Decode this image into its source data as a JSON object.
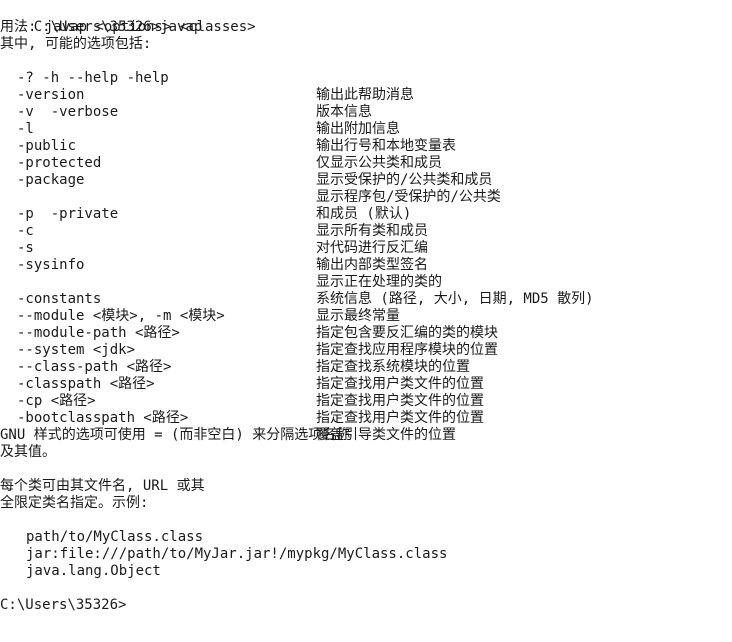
{
  "prompt": {
    "cwd": "C:\\Users\\35326>",
    "command": "javap"
  },
  "usage": {
    "line1": "用法: javap <options> <classes>",
    "line2": "其中, 可能的选项包括:"
  },
  "options": [
    {
      "opt": "-? -h --help -help",
      "desc": "输出此帮助消息"
    },
    {
      "opt": "-version",
      "desc": "版本信息"
    },
    {
      "opt": "-v  -verbose",
      "desc": "输出附加信息"
    },
    {
      "opt": "-l",
      "desc": "输出行号和本地变量表"
    },
    {
      "opt": "-public",
      "desc": "仅显示公共类和成员"
    },
    {
      "opt": "-protected",
      "desc": "显示受保护的/公共类和成员"
    },
    {
      "opt": "-package",
      "desc": "显示程序包/受保护的/公共类"
    },
    {
      "opt": "",
      "desc": "和成员 (默认)"
    },
    {
      "opt": "-p  -private",
      "desc": "显示所有类和成员"
    },
    {
      "opt": "-c",
      "desc": "对代码进行反汇编"
    },
    {
      "opt": "-s",
      "desc": "输出内部类型签名"
    },
    {
      "opt": "-sysinfo",
      "desc": "显示正在处理的类的"
    },
    {
      "opt": "",
      "desc": "系统信息 (路径, 大小, 日期, MD5 散列)"
    },
    {
      "opt": "-constants",
      "desc": "显示最终常量"
    },
    {
      "opt": "--module <模块>, -m <模块>",
      "desc": "指定包含要反汇编的类的模块"
    },
    {
      "opt": "--module-path <路径>",
      "desc": "指定查找应用程序模块的位置"
    },
    {
      "opt": "--system <jdk>",
      "desc": "指定查找系统模块的位置"
    },
    {
      "opt": "--class-path <路径>",
      "desc": "指定查找用户类文件的位置"
    },
    {
      "opt": "-classpath <路径>",
      "desc": "指定查找用户类文件的位置"
    },
    {
      "opt": "-cp <路径>",
      "desc": "指定查找用户类文件的位置"
    },
    {
      "opt": "-bootclasspath <路径>",
      "desc": "覆盖引导类文件的位置"
    }
  ],
  "gnu_note": {
    "line1": "GNU 样式的选项可使用 = (而非空白) 来分隔选项名称",
    "line2": "及其值。"
  },
  "class_note": {
    "line1": "每个类可由其文件名, URL 或其",
    "line2": "全限定类名指定。示例:"
  },
  "examples": [
    "path/to/MyClass.class",
    "jar:file:///path/to/MyJar.jar!/mypkg/MyClass.class",
    "java.lang.Object"
  ],
  "final_prompt": "C:\\Users\\35326>"
}
